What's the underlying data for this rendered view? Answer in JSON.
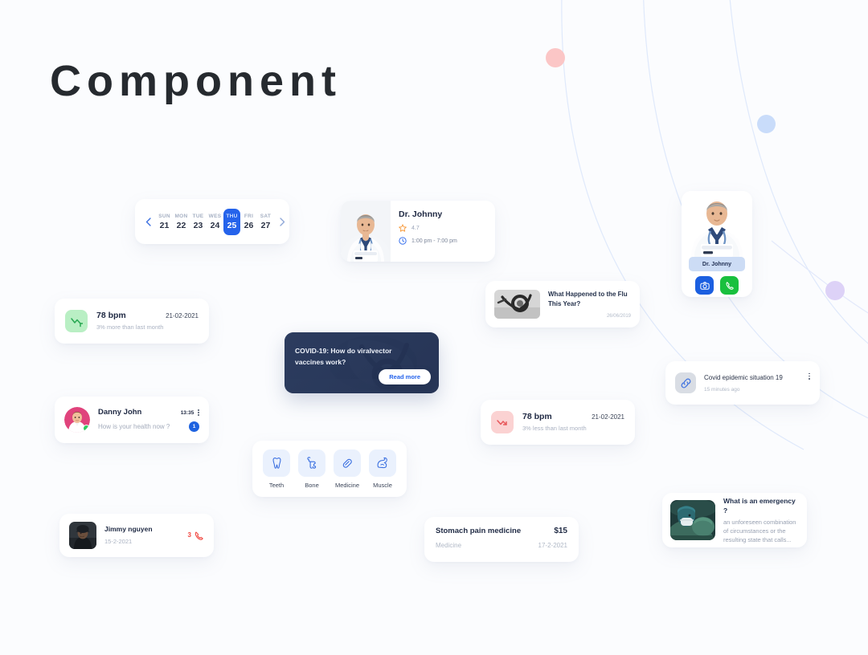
{
  "page": {
    "title": "Component",
    "background": "#fbfcfe"
  },
  "colors": {
    "primary_blue": "#2563eb",
    "green": "#19c03e",
    "red": "#f1463f",
    "pink_dot": "#fbc6c6",
    "blue_dot": "#c9dcfa",
    "purple_dot": "#ddd2f7",
    "arc": "#dde7fb"
  },
  "calendar": {
    "prev_icon": "chevron-left-icon",
    "next_icon": "chevron-right-icon",
    "days": [
      {
        "dow": "SUN",
        "num": "21",
        "selected": false
      },
      {
        "dow": "MON",
        "num": "22",
        "selected": false
      },
      {
        "dow": "TUE",
        "num": "23",
        "selected": false
      },
      {
        "dow": "WES",
        "num": "24",
        "selected": false
      },
      {
        "dow": "THU",
        "num": "25",
        "selected": true
      },
      {
        "dow": "FRI",
        "num": "26",
        "selected": false
      },
      {
        "dow": "SAT",
        "num": "27",
        "selected": false
      }
    ]
  },
  "doctor_card": {
    "name": "Dr. Johnny",
    "rating": "4.7",
    "rating_icon": "star-icon",
    "hours": "1:00 pm - 7:00 pm",
    "hours_icon": "clock-icon",
    "photo_alt": "doctor-portrait"
  },
  "bpm_up": {
    "icon": "trend-up-arrow-icon",
    "value": "78 bpm",
    "date": "21-02-2021",
    "subtitle": "3% more than last month",
    "tile_color": "#b9efc4",
    "arrow_color": "#28a852"
  },
  "bpm_down": {
    "icon": "trend-down-arrow-icon",
    "value": "78 bpm",
    "date": "21-02-2021",
    "subtitle": "3% less than last month",
    "tile_color": "#fbd2d2",
    "arrow_color": "#e8575a"
  },
  "chat": {
    "name": "Danny John",
    "time": "13:35",
    "message": "How is your health now ?",
    "unread": "1",
    "menu_icon": "kebab-menu-icon",
    "status": "online",
    "avatar_alt": "danny-john-avatar"
  },
  "covid_card": {
    "title": "COVID-19: How do viralvector vaccines work?",
    "button": "Read more",
    "image_alt": "stethoscope-photo"
  },
  "flu_card": {
    "title": "What Happened to the Flu This Year?",
    "date": "26/06/2019",
    "image_alt": "stethoscope-grayscale-thumb"
  },
  "profile_card": {
    "name": "Dr. Johnny",
    "camera_icon": "camera-icon",
    "call_icon": "phone-icon",
    "photo_alt": "doctor-portrait"
  },
  "link_card": {
    "title": "Covid epidemic situation 19",
    "subtitle": "15 minutes ago",
    "icon": "link-chain-icon",
    "menu_icon": "kebab-menu-icon"
  },
  "categories": [
    {
      "label": "Teeth",
      "icon": "tooth-icon"
    },
    {
      "label": "Bone",
      "icon": "bone-icon"
    },
    {
      "label": "Medicine",
      "icon": "capsule-pill-icon"
    },
    {
      "label": "Muscle",
      "icon": "flexed-biceps-icon"
    }
  ],
  "call_card": {
    "name": "Jimmy nguyen",
    "date": "15-2-2021",
    "count": "3",
    "icon": "phone-missed-icon",
    "photo_alt": "jimmy-nguyen-photo"
  },
  "price_card": {
    "name": "Stomach pain medicine",
    "amount": "$15",
    "category": "Medicine",
    "date": "17-2-2021"
  },
  "emergency_card": {
    "title": "What is an emergency ?",
    "text": "an unforeseen combination of circumstances or the resulting state that calls...",
    "image_alt": "surgery-room-photo"
  }
}
